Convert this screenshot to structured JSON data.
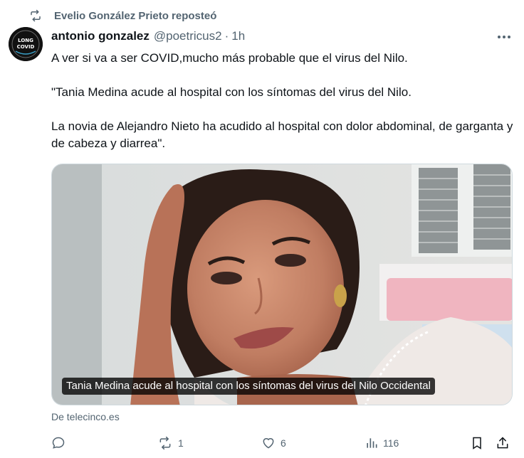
{
  "repost": {
    "icon": "repost-icon",
    "text": "Evelio González Prieto reposteó"
  },
  "author": {
    "avatar_text_top": "LONG",
    "avatar_text_bottom": "COVID",
    "name": "antonio gonzalez",
    "handle": "@poetricus2",
    "separator": "·",
    "time": "1h"
  },
  "tweet": {
    "lines": [
      "A ver si va a ser COVID,mucho más probable que el virus del Nilo.",
      "\"Tania Medina acude al hospital con los síntomas del virus del Nilo.",
      "La novia de Alejandro Nieto ha acudido al hospital con dolor abdominal, de garganta y de cabeza y diarrea\"."
    ]
  },
  "card": {
    "caption": "Tania Medina acude al hospital con los síntomas del virus del Nilo Occidental",
    "source": "De telecinco.es"
  },
  "actions": {
    "reply": {
      "icon": "reply-icon",
      "count": ""
    },
    "repost": {
      "icon": "repost-icon",
      "count": "1"
    },
    "like": {
      "icon": "heart-icon",
      "count": "6"
    },
    "views": {
      "icon": "views-icon",
      "count": "116"
    },
    "bookmark": {
      "icon": "bookmark-icon"
    },
    "share": {
      "icon": "share-icon"
    }
  },
  "colors": {
    "text": "#0f1419",
    "secondary": "#536471",
    "border": "#cfd9de"
  }
}
